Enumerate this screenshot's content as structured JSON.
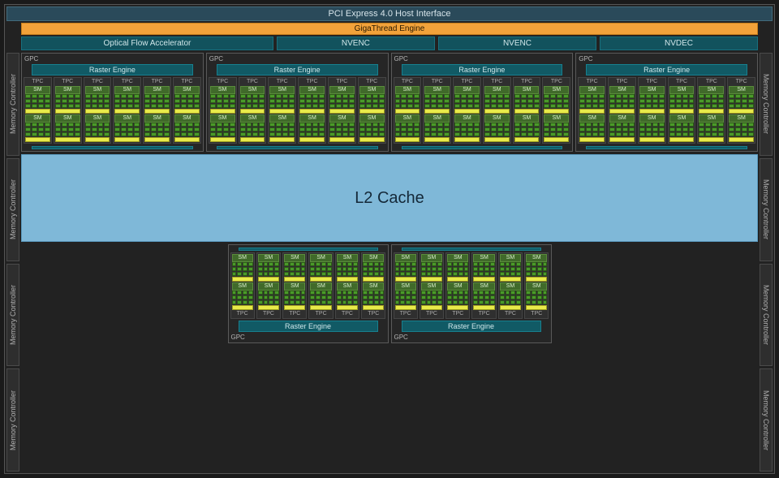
{
  "pcie": "PCI Express 4.0 Host Interface",
  "giga": "GigaThread Engine",
  "engines": {
    "ofa": "Optical Flow Accelerator",
    "nvenc1": "NVENC",
    "nvenc2": "NVENC",
    "nvdec": "NVDEC"
  },
  "mc_label": "Memory Controller",
  "l2": "L2 Cache",
  "gpc": {
    "label": "GPC",
    "raster": "Raster Engine",
    "tpc": "TPC",
    "sm": "SM"
  },
  "layout": {
    "mem_controllers_per_side": 4,
    "top_gpcs": 4,
    "bottom_gpcs": 2,
    "tpcs_per_gpc": 6,
    "sms_per_tpc": 2,
    "core_rows_per_sm": 3,
    "core_cols_per_sm": 4
  }
}
